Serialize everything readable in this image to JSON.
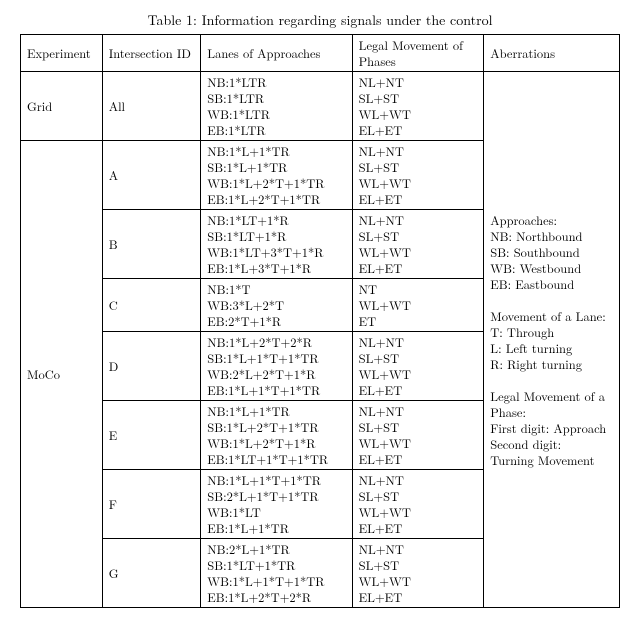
{
  "caption": "Table 1: Information regarding signals under the control",
  "headers": {
    "experiment": "Experiment",
    "intersection_id": "Intersection ID",
    "lanes": "Lanes of Approaches",
    "legal": "Legal Movement of Phases",
    "aberrations": "Aberrations"
  },
  "grid": {
    "experiment": "Grid",
    "id": "All",
    "lanes": "NB:1*LTR\nSB:1*LTR\nWB:1*LTR\nEB:1*LTR",
    "legal": "NL+NT\nSL+ST\nWL+WT\nEL+ET"
  },
  "moco": {
    "experiment": "MoCo",
    "rows": [
      {
        "id": "A",
        "lanes": "NB:1*L+1*TR\nSB:1*L+1*TR\nWB:1*L+2*T+1*TR\nEB:1*L+2*T+1*TR",
        "legal": "NL+NT\nSL+ST\nWL+WT\nEL+ET"
      },
      {
        "id": "B",
        "lanes": "NB:1*LT+1*R\nSB:1*LT+1*R\nWB:1*LT+3*T+1*R\nEB:1*L+3*T+1*R",
        "legal": "NL+NT\nSL+ST\nWL+WT\nEL+ET"
      },
      {
        "id": "C",
        "lanes": "NB:1*T\nWB:3*L+2*T\nEB:2*T+1*R",
        "legal": "NT\nWL+WT\nET"
      },
      {
        "id": "D",
        "lanes": "NB:1*L+2*T+2*R\nSB:1*L+1*T+1*TR\nWB:2*L+2*T+1*R\nEB:1*L+1*T+1*TR",
        "legal": "NL+NT\nSL+ST\nWL+WT\nEL+ET"
      },
      {
        "id": "E",
        "lanes": "NB:1*L+1*TR\nSB:1*L+2*T+1*TR\nWB:1*L+2*T+1*R\nEB:1*LT+1*T+1*TR",
        "legal": "NL+NT\nSL+ST\nWL+WT\nEL+ET"
      },
      {
        "id": "F",
        "lanes": "NB:1*L+1*T+1*TR\nSB:2*L+1*T+1*TR\nWB:1*LT\nEB:1*L+1*TR",
        "legal": "NL+NT\nSL+ST\nWL+WT\nEL+ET"
      },
      {
        "id": "G",
        "lanes": "NB:2*L+1*TR\nSB:1*LT+1*TR\nWB:1*L+1*T+1*TR\nEB:1*L+2*T+2*R",
        "legal": "NL+NT\nSL+ST\nWL+WT\nEL+ET"
      }
    ]
  },
  "aberrations_text": "Approaches:\nNB: Northbound\nSB: Southbound\nWB: Westbound\nEB: Eastbound\n\nMovement of a Lane:\nT: Through\nL: Left turning\nR: Right turning\n\nLegal Movement of a Phase:\nFirst digit: Approach\nSecond digit:\nTurning Movement"
}
